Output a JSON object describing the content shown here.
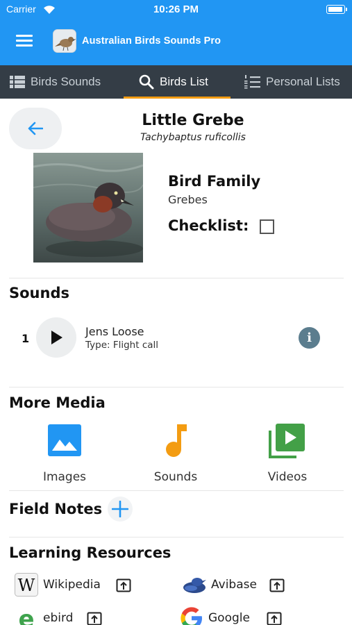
{
  "status_bar": {
    "carrier": "Carrier",
    "time": "10:26 PM"
  },
  "header": {
    "app_title": "Australian Birds Sounds Pro"
  },
  "tabs": [
    {
      "label": "Birds Sounds",
      "icon": "list-grid-icon",
      "active": false
    },
    {
      "label": "Birds List",
      "icon": "search-icon",
      "active": true
    },
    {
      "label": "Personal Lists",
      "icon": "numbered-list-icon",
      "active": false
    }
  ],
  "bird": {
    "name": "Little Grebe",
    "scientific_name": "Tachybaptus ruficollis",
    "family_label": "Bird Family",
    "family": "Grebes",
    "checklist_label": "Checklist:",
    "checklist_checked": false
  },
  "sounds": {
    "title": "Sounds",
    "items": [
      {
        "number": "1",
        "recordist": "Jens Loose",
        "type": "Type: Flight call"
      }
    ]
  },
  "media": {
    "title": "More Media",
    "items": [
      {
        "label": "Images",
        "icon": "image-icon",
        "color": "#2196f3"
      },
      {
        "label": "Sounds",
        "icon": "music-note-icon",
        "color": "#f39c12"
      },
      {
        "label": "Videos",
        "icon": "video-library-icon",
        "color": "#43a047"
      }
    ]
  },
  "field_notes": {
    "title": "Field Notes"
  },
  "learning": {
    "title": "Learning Resources",
    "items": [
      {
        "label": "Wikipedia",
        "icon": "wikipedia-logo-icon"
      },
      {
        "label": "Avibase",
        "icon": "avibase-logo-icon"
      },
      {
        "label": "ebird",
        "icon": "ebird-logo-icon"
      },
      {
        "label": "Google",
        "icon": "google-logo-icon"
      }
    ]
  },
  "colors": {
    "primary": "#2196f3",
    "tab_bar": "#343d46",
    "tab_indicator": "#f39c12",
    "info": "#5b7d8e"
  }
}
